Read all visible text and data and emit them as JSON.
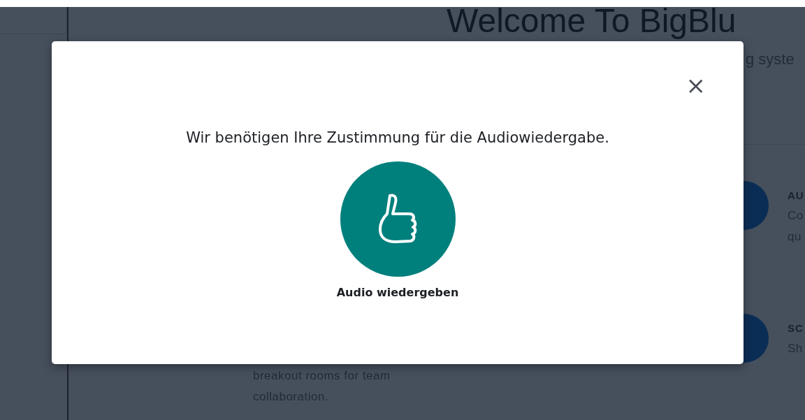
{
  "background_page": {
    "heading": "Welcome To BigBlu",
    "subheading": "g syste",
    "features": [
      {
        "kind": "titled",
        "title": "AU",
        "description": "Co\nqu"
      },
      {
        "kind": "text",
        "description": "breakout rooms for team collaboration."
      },
      {
        "kind": "icon"
      },
      {
        "kind": "titled",
        "title": "SC",
        "description": "Sh"
      }
    ]
  },
  "modal": {
    "title": "Wir benötigen Ihre Zustimmung für die Audiowiedergabe.",
    "close_label": "×",
    "play_button": {
      "label": "Audio wiedergeben"
    }
  }
}
